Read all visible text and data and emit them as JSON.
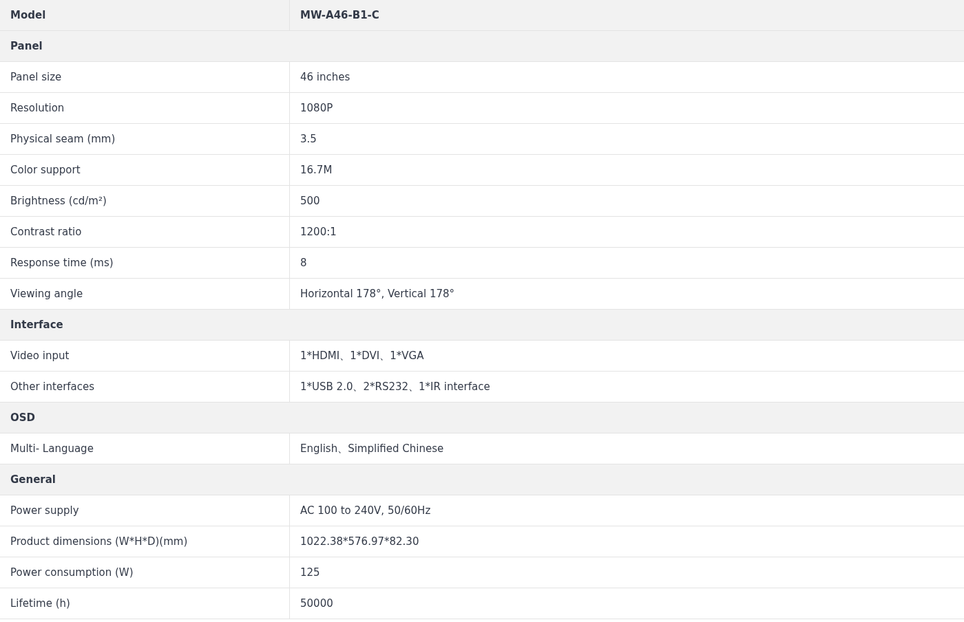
{
  "spec_table": {
    "rows": [
      {
        "kind": "header",
        "label": "Model",
        "value": "MW-A46-B1-C"
      },
      {
        "kind": "section",
        "label": "Panel"
      },
      {
        "kind": "spec",
        "label": "Panel size",
        "value": "46 inches"
      },
      {
        "kind": "spec",
        "label": "Resolution",
        "value": "1080P"
      },
      {
        "kind": "spec",
        "label": "Physical seam (mm)",
        "value": "3.5"
      },
      {
        "kind": "spec",
        "label": "Color support",
        "value": "16.7M"
      },
      {
        "kind": "spec",
        "label": "Brightness (cd/m²)",
        "value": "500"
      },
      {
        "kind": "spec",
        "label": "Contrast ratio",
        "value": "1200:1"
      },
      {
        "kind": "spec",
        "label": "Response time (ms)",
        "value": "8"
      },
      {
        "kind": "spec",
        "label": "Viewing angle",
        "value": "Horizontal 178°, Vertical 178°"
      },
      {
        "kind": "section",
        "label": "Interface"
      },
      {
        "kind": "spec",
        "label": "Video input",
        "value": "1*HDMI、1*DVI、1*VGA"
      },
      {
        "kind": "spec",
        "label": "Other interfaces",
        "value": "1*USB 2.0、2*RS232、1*IR interface"
      },
      {
        "kind": "section",
        "label": "OSD"
      },
      {
        "kind": "spec",
        "label": "Multi- Language",
        "value": "English、Simplified Chinese"
      },
      {
        "kind": "section",
        "label": "General"
      },
      {
        "kind": "spec",
        "label": "Power supply",
        "value": "AC 100 to 240V, 50/60Hz"
      },
      {
        "kind": "spec",
        "label": "Product dimensions (W*H*D)(mm)",
        "value": "1022.38*576.97*82.30"
      },
      {
        "kind": "spec",
        "label": "Power consumption (W)",
        "value": "125"
      },
      {
        "kind": "spec",
        "label": "Lifetime (h)",
        "value": "50000"
      }
    ]
  }
}
